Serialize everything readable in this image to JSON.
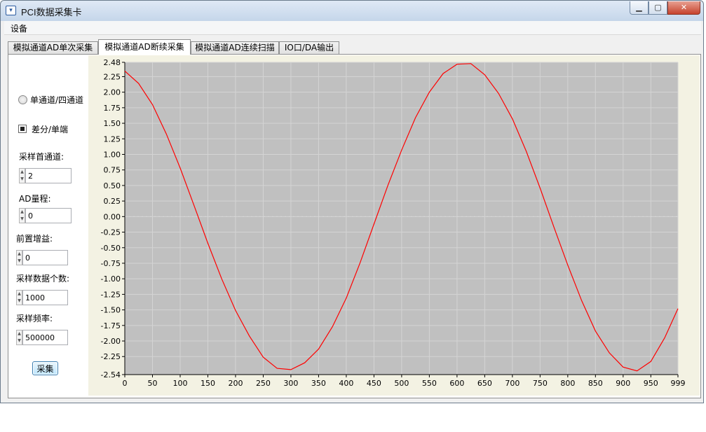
{
  "window": {
    "title": "PCI数据采集卡"
  },
  "menu": {
    "items": [
      "设备"
    ]
  },
  "tabs": [
    {
      "label": "模拟通道AD单次采集",
      "active": false
    },
    {
      "label": "模拟通道AD断续采集",
      "active": true
    },
    {
      "label": "模拟通道AD连续扫描",
      "active": false
    },
    {
      "label": "IO口/DA输出",
      "active": false
    }
  ],
  "controls": {
    "channel_mode": {
      "label": "单通道/四通道",
      "checked": false
    },
    "diff_single": {
      "label": "差分/单端",
      "checked": true
    },
    "first_channel": {
      "label": "采样首通道:",
      "value": "2"
    },
    "ad_range": {
      "label": "AD量程:",
      "value": "0"
    },
    "pre_gain": {
      "label": "前置增益:",
      "value": "0"
    },
    "sample_count": {
      "label": "采样数据个数:",
      "value": "1000"
    },
    "sample_freq": {
      "label": "采样频率:",
      "value": "500000"
    },
    "acquire_button": {
      "label": "采集"
    }
  },
  "chart_data": {
    "type": "line",
    "title": "",
    "xlabel": "",
    "ylabel": "",
    "xlim": [
      0,
      999
    ],
    "ylim": [
      -2.54,
      2.48
    ],
    "x_ticks": [
      "0",
      "50",
      "100",
      "150",
      "200",
      "250",
      "300",
      "350",
      "400",
      "450",
      "500",
      "550",
      "600",
      "650",
      "700",
      "750",
      "800",
      "850",
      "900",
      "950",
      "999"
    ],
    "y_ticks": [
      "2.48",
      "2.25",
      "2.00",
      "1.75",
      "1.50",
      "1.25",
      "1.00",
      "0.75",
      "0.50",
      "0.25",
      "0.00",
      "-0.25",
      "-0.50",
      "-0.75",
      "-1.00",
      "-1.25",
      "-1.50",
      "-1.75",
      "-2.00",
      "-2.25",
      "-2.54"
    ],
    "grid": true,
    "plot_background": "#c0c0c0",
    "line_color": "#ff0000",
    "series": [
      {
        "x": [
          0,
          25,
          50,
          75,
          100,
          125,
          150,
          175,
          200,
          225,
          250,
          275,
          300,
          325,
          350,
          375,
          400,
          425,
          450,
          475,
          500,
          525,
          550,
          575,
          600,
          625,
          650,
          675,
          700,
          725,
          750,
          775,
          800,
          825,
          850,
          875,
          900,
          925,
          950,
          975,
          999
        ],
        "values": [
          2.34,
          2.14,
          1.8,
          1.33,
          0.78,
          0.18,
          -0.43,
          -1.0,
          -1.51,
          -1.92,
          -2.26,
          -2.44,
          -2.46,
          -2.35,
          -2.13,
          -1.77,
          -1.31,
          -0.74,
          -0.12,
          0.5,
          1.07,
          1.59,
          2.0,
          2.3,
          2.45,
          2.46,
          2.28,
          1.98,
          1.57,
          1.05,
          0.46,
          -0.17,
          -0.78,
          -1.35,
          -1.84,
          -2.19,
          -2.42,
          -2.48,
          -2.33,
          -1.95,
          -1.48
        ]
      }
    ]
  }
}
